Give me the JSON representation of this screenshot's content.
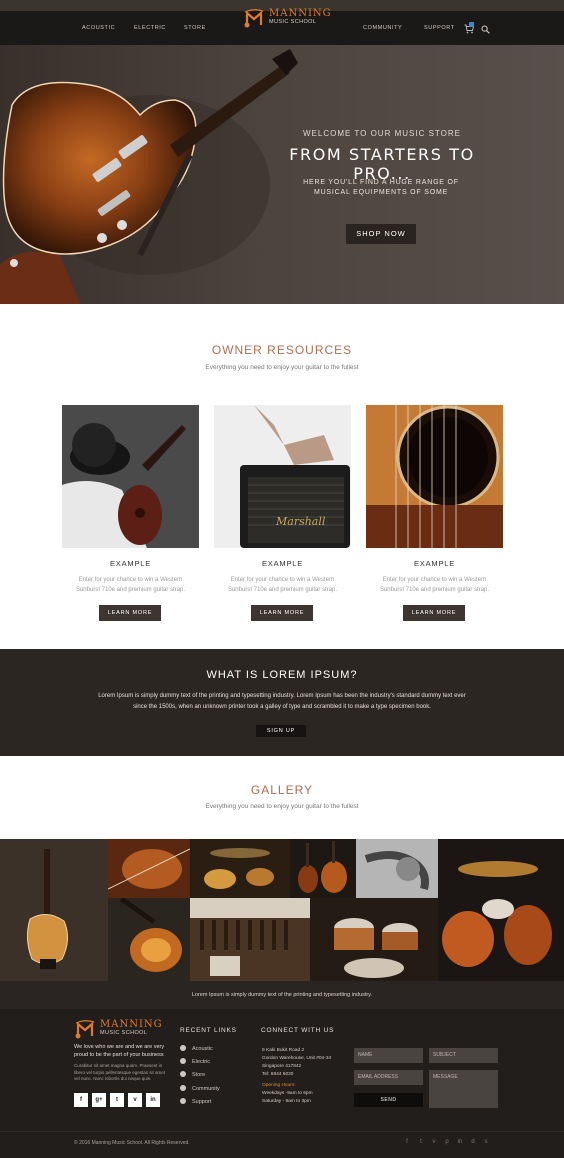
{
  "nav": {
    "left": [
      "ACOUSTIC",
      "ELECTRIC",
      "STORE"
    ],
    "right": [
      "COMMUNITY",
      "SUPPORT"
    ],
    "logo_title": "MANNING",
    "logo_sub": "MUSIC SCHOOL",
    "icons": [
      "cart-icon",
      "search-icon"
    ]
  },
  "hero": {
    "welcome": "WELCOME TO OUR MUSIC STORE",
    "title": "FROM STARTERS TO PRO...",
    "desc_line1": "HERE YOU'LL FIND A HUGE RANGE OF",
    "desc_line2": "MUSICAL EQUIPMENTS OF SOME",
    "button": "SHOP NOW"
  },
  "resources": {
    "title": "OWNER RESOURCES",
    "subtitle": "Everything you need to enjoy your guitar to the fullest",
    "cards": [
      {
        "title": "EXAMPLE",
        "text1": "Enter for your chance to win a Western",
        "text2": "Sunburst 710e and premium guitar strap.",
        "button": "LEARN MORE"
      },
      {
        "title": "EXAMPLE",
        "text1": "Enter for your chance to win a Western",
        "text2": "Sunburst 710e and premium guitar strap.",
        "button": "LEARN MORE"
      },
      {
        "title": "EXAMPLE",
        "text1": "Enter for your chance to win a Western",
        "text2": "Sunburst 710e and premium guitar strap.",
        "button": "LEARN MORE"
      }
    ],
    "amp_brand": "Marshall"
  },
  "lorem": {
    "title": "WHAT IS LOREM IPSUM?",
    "line1": "Lorem Ipsum is simply dummy text of the printing and typesetting industry. Lorem Ipsum has been the industry's standard dummy text ever",
    "line2": "since the 1500s, when an unknown printer took a galley of type and scrambled it to make a type specimen book.",
    "button": "SIGN UP"
  },
  "gallery": {
    "title": "GALLERY",
    "subtitle": "Everything you need to enjoy your guitar to the fullest",
    "caption": "Lorem Ipsum is simply dummy text of the printing and typesetting industry."
  },
  "footer": {
    "logo_title": "MANNING",
    "logo_sub": "MUSIC SCHOOL",
    "about": "We love who we are and we are very proud to be the part of your business",
    "small": "Curabitur sit amet magna quam. Praesent in libero vel turpis pellentesque egestas sit amet vel nunc. Nunc lobortis dui neque quis.",
    "social": [
      "f",
      "g+",
      "t",
      "v",
      "in"
    ],
    "links_title": "RECENT LINKS",
    "links": [
      "Acoustic",
      "Electric",
      "Store",
      "Community",
      "Support"
    ],
    "connect_title": "CONNECT WITH US",
    "address": [
      "9 Kaki Bukit Road 2",
      "Gordon Warehouse, Unit #04-34",
      "Singapore 417842",
      "Tel: 6844 6030"
    ],
    "hours_title": "Opening Hours:",
    "hours": [
      "Weekdays -9am to 6pm",
      "Saturday - 9am to 3pm"
    ],
    "form": {
      "name": "NAME",
      "subject": "SUBJECT",
      "email": "EMAIL ADDRESS",
      "message": "MESSAGE",
      "send": "SEND"
    },
    "copyright": "© 2016 Manning Music School. All Rights Reserved.",
    "bottom_icons": [
      "f",
      "t",
      "v",
      "p",
      "in",
      "d",
      "s"
    ]
  },
  "colors": {
    "accent": "#b36d4f",
    "orange": "#e07b2c",
    "dark": "#2c2623",
    "nav": "#1b1918",
    "cart_badge": "#2f8ee0"
  }
}
